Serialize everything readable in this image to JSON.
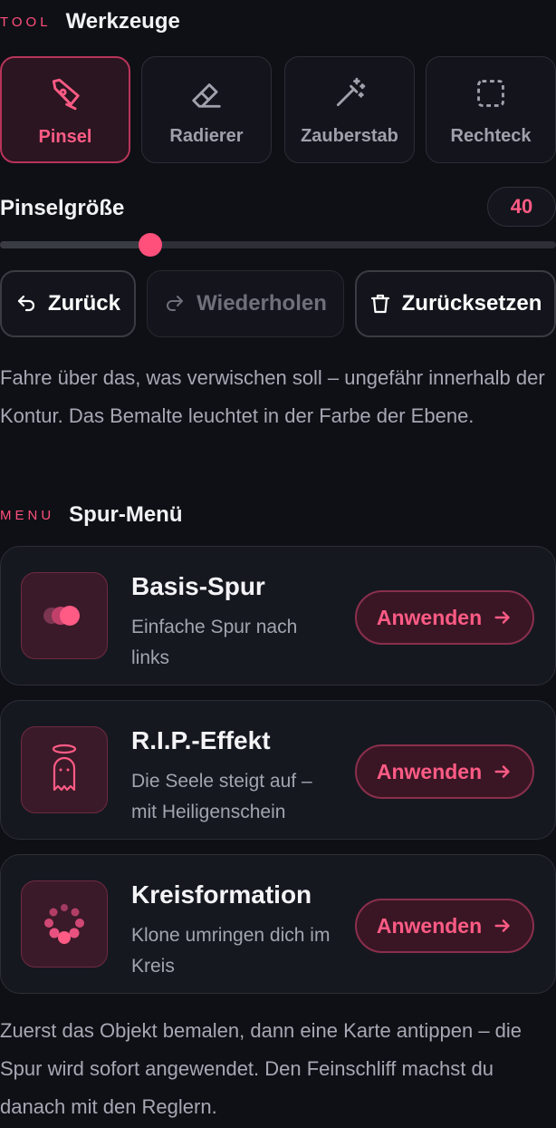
{
  "tools_section": {
    "eyebrow": "TOOL",
    "title": "Werkzeuge"
  },
  "tools": [
    {
      "label": "Pinsel",
      "icon": "pen-nib-icon",
      "active": true
    },
    {
      "label": "Radierer",
      "icon": "eraser-icon",
      "active": false
    },
    {
      "label": "Zauberstab",
      "icon": "magic-wand-icon",
      "active": false
    },
    {
      "label": "Rechteck",
      "icon": "dashed-rectangle-icon",
      "active": false
    }
  ],
  "brush_size": {
    "label": "Pinselgröße",
    "value": "40",
    "level": 0.27
  },
  "actions": [
    {
      "label": "Zurück",
      "icon": "undo-icon",
      "enabled": true
    },
    {
      "label": "Wiederholen",
      "icon": "redo-icon",
      "enabled": false
    },
    {
      "label": "Zurücksetzen",
      "icon": "trash-icon",
      "enabled": true
    }
  ],
  "tool_hint": "Fahre über das, was verwischen soll – ungefähr innerhalb der Kontur. Das Bemalte leuchtet in der Farbe der Ebene.",
  "menu_section": {
    "eyebrow": "MENU",
    "title": "Spur-Menü"
  },
  "presets": [
    {
      "title": "Basis-Spur",
      "description": "Einfache Spur nach links",
      "icon": "trail-dots-icon",
      "apply_label": "Anwenden"
    },
    {
      "title": "R.I.P.-Effekt",
      "description": "Die Seele steigt auf – mit Heiligenschein",
      "icon": "ghost-halo-icon",
      "apply_label": "Anwenden"
    },
    {
      "title": "Kreisformation",
      "description": "Klone umringen dich im Kreis",
      "icon": "circle-clones-icon",
      "apply_label": "Anwenden"
    }
  ],
  "footer_hint": "Zuerst das Objekt bemalen, dann eine Karte antippen – die Spur wird sofort angewendet. Den Feinschliff machst du danach mit den Reglern.",
  "colors": {
    "accent": "#ff4f7b",
    "background": "#0f1016"
  }
}
